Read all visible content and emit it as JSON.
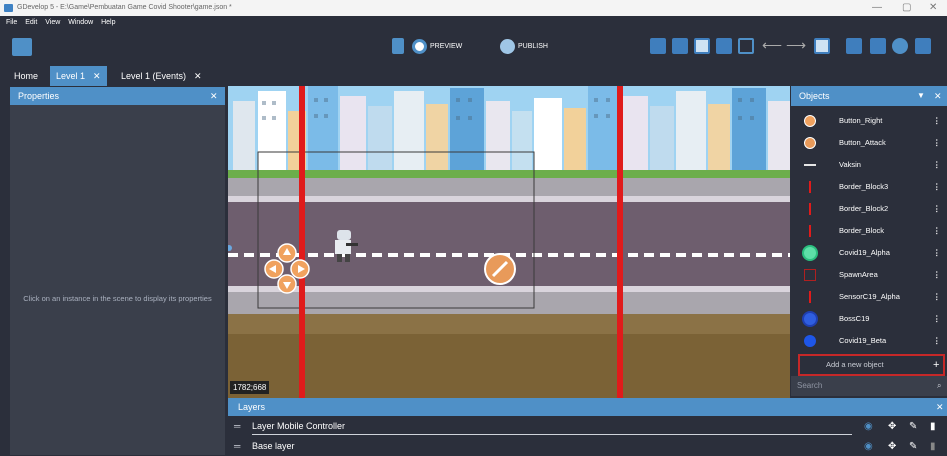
{
  "window": {
    "title": "GDevelop 5 - E:\\Game\\Pembuatan Game Covid Shooter\\game.json *",
    "controls": [
      "—",
      "▢",
      "✕"
    ]
  },
  "menu": [
    "File",
    "Edit",
    "View",
    "Window",
    "Help"
  ],
  "toolbar": {
    "preview_label": "PREVIEW",
    "publish_label": "PUBLISH"
  },
  "tabs": [
    {
      "label": "Home"
    },
    {
      "label": "Level 1",
      "close": "✕"
    },
    {
      "label": "Level 1 (Events)",
      "close": "✕"
    }
  ],
  "properties": {
    "title": "Properties",
    "close": "✕",
    "hint": "Click on an instance in the scene to display its properties"
  },
  "scene": {
    "coordinates": "1782;668"
  },
  "objects": {
    "title": "Objects",
    "items": [
      {
        "name": "Button_Right",
        "icon": "arrow-right-icon"
      },
      {
        "name": "Button_Attack",
        "icon": "attack-icon"
      },
      {
        "name": "Vaksin",
        "icon": "vaccine-icon"
      },
      {
        "name": "Border_Block3",
        "icon": "border-icon"
      },
      {
        "name": "Border_Block2",
        "icon": "border-icon"
      },
      {
        "name": "Border_Block",
        "icon": "border-icon"
      },
      {
        "name": "Covid19_Alpha",
        "icon": "virus-icon"
      },
      {
        "name": "SpawnArea",
        "icon": "area-icon"
      },
      {
        "name": "SensorC19_Alpha",
        "icon": "sensor-icon"
      },
      {
        "name": "BossC19",
        "icon": "boss-virus-icon"
      },
      {
        "name": "Covid19_Beta",
        "icon": "virus-icon"
      }
    ],
    "add_label": "Add a new object",
    "search_placeholder": "Search"
  },
  "layers": {
    "title": "Layers",
    "close": "✕",
    "items": [
      {
        "name": "Layer Mobile Controller"
      },
      {
        "name": "Base layer"
      }
    ]
  },
  "colors": {
    "accent": "#4f90c7",
    "panel": "#2b2f3b",
    "red_border": "#e01b1b"
  }
}
